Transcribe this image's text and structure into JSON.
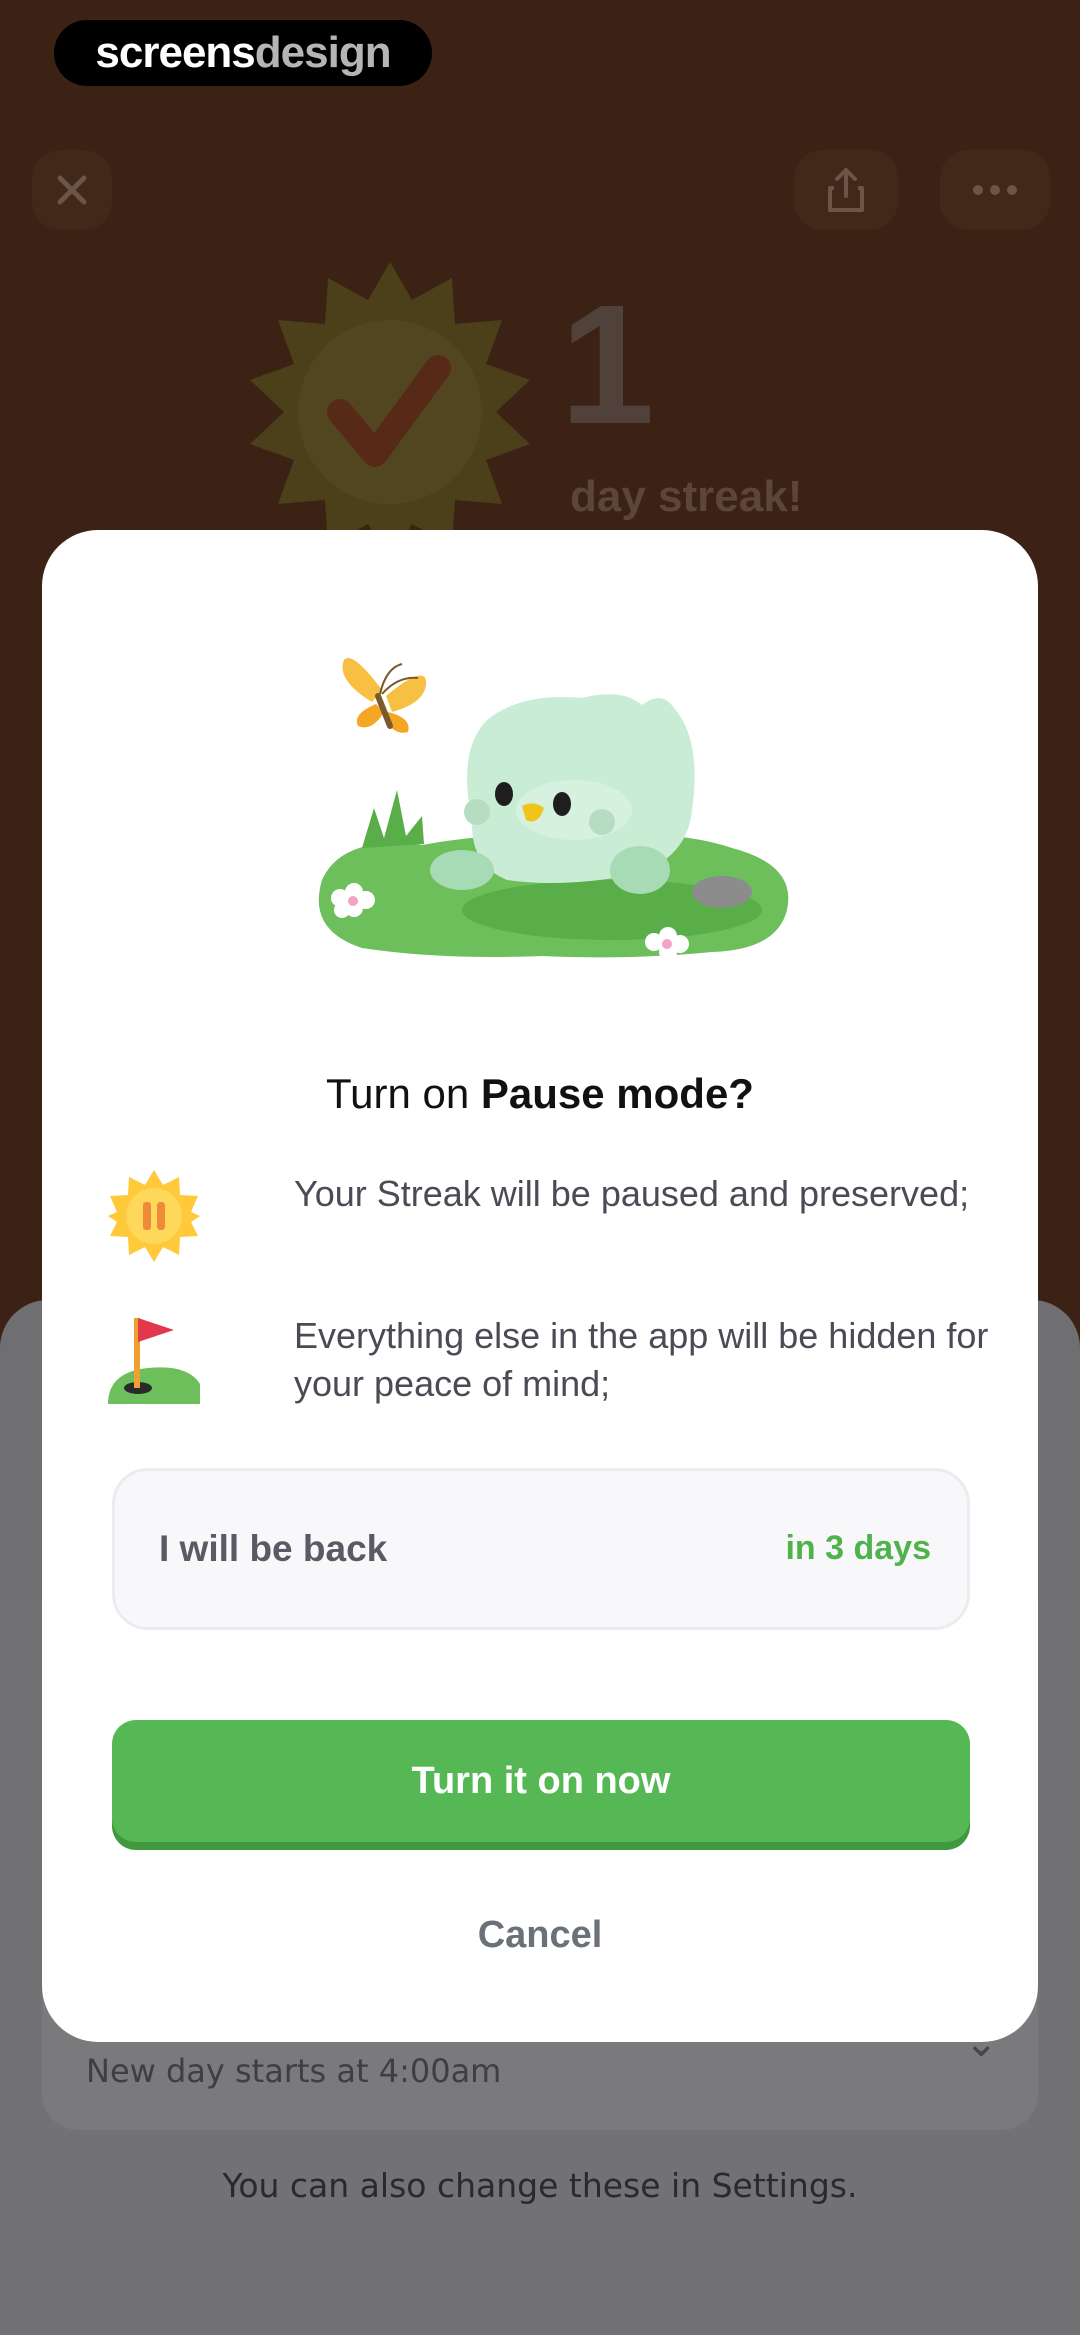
{
  "watermark": {
    "part1": "screens",
    "part2": "design"
  },
  "background": {
    "close_icon": "close-icon",
    "share_icon": "share-icon",
    "more_icon": "more-icon",
    "streak_count": "1",
    "streak_label": "day streak!",
    "row_sub": "New day starts at 4:00am",
    "footnote": "You can also change these in Settings."
  },
  "modal": {
    "title_prefix": "Turn on ",
    "title_bold": "Pause mode?",
    "bullets": [
      {
        "icon": "paused-sun-icon",
        "text": "Your Streak will be paused and preserved;"
      },
      {
        "icon": "golf-flag-icon",
        "text": "Everything else in the app will be hidden for your peace of mind;"
      }
    ],
    "back_label": "I will be back",
    "back_value": "in 3 days",
    "primary_label": "Turn it on now",
    "cancel_label": "Cancel"
  },
  "colors": {
    "accent_green": "#56b855",
    "value_green": "#4fb24b",
    "backdrop": "#3b2214"
  }
}
